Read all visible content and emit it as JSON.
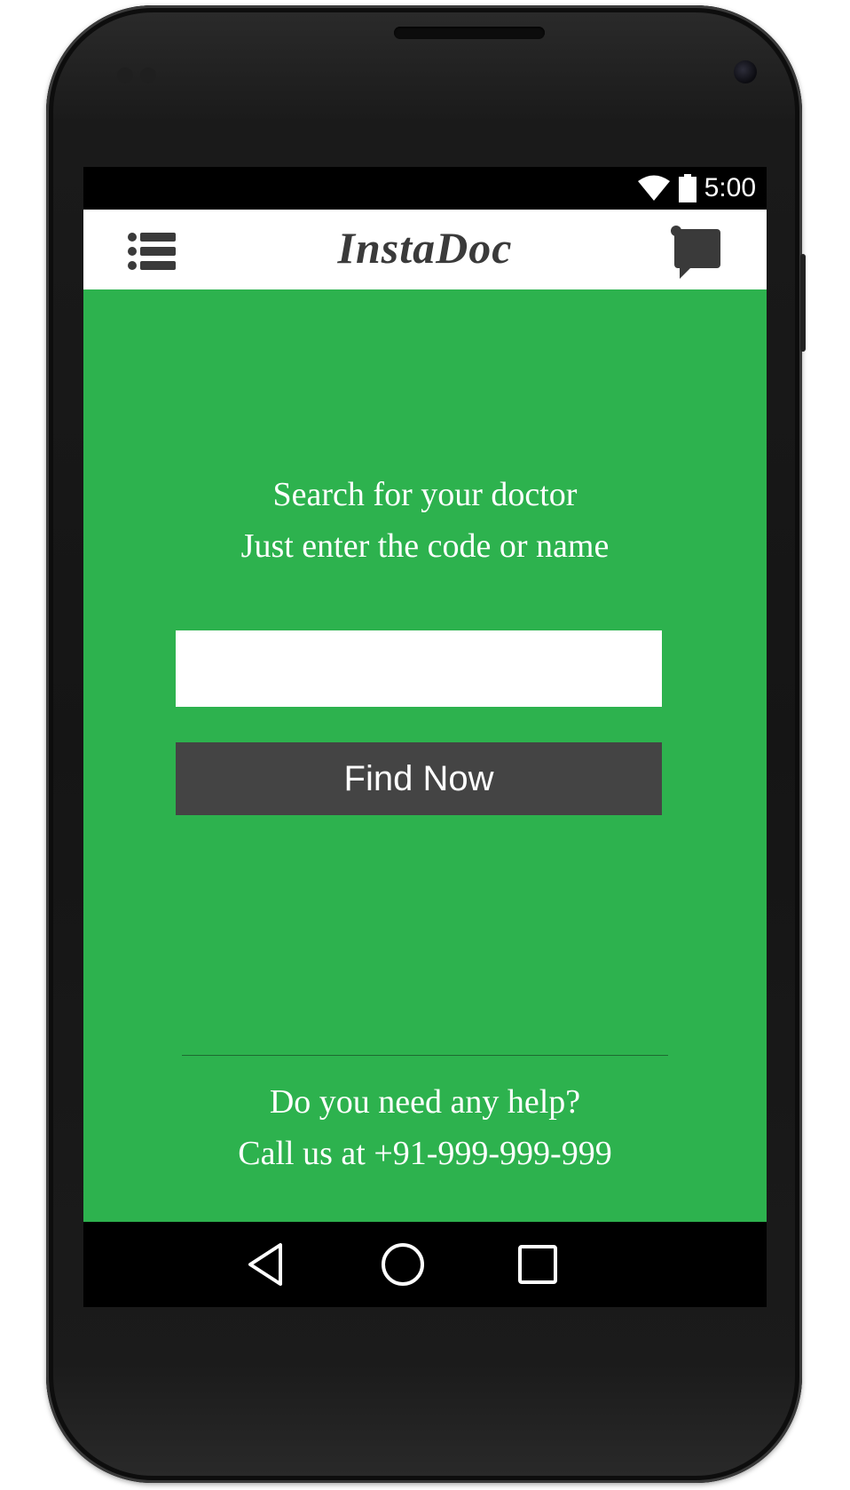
{
  "device": {
    "frame_color": "#1a1a1a"
  },
  "status_bar": {
    "time": "5:00",
    "icons": [
      "wifi-icon",
      "battery-icon"
    ]
  },
  "app_bar": {
    "title": "InstaDoc",
    "menu_icon": "list-menu-icon",
    "chat_icon": "chat-bubble-icon"
  },
  "search": {
    "heading_line1": "Search for your doctor",
    "heading_line2": "Just enter the code or name",
    "input_value": "",
    "input_placeholder": "",
    "button_label": "Find Now"
  },
  "help": {
    "line1": "Do you need any help?",
    "line2": "Call us at +91-999-999-999"
  },
  "nav_bar": {
    "icons": [
      "back-icon",
      "home-icon",
      "recents-icon"
    ]
  },
  "colors": {
    "background": "#2db24e",
    "app_bar": "#ffffff",
    "button": "#444444",
    "text_light": "#ffffff",
    "title": "#3a3a3a"
  }
}
